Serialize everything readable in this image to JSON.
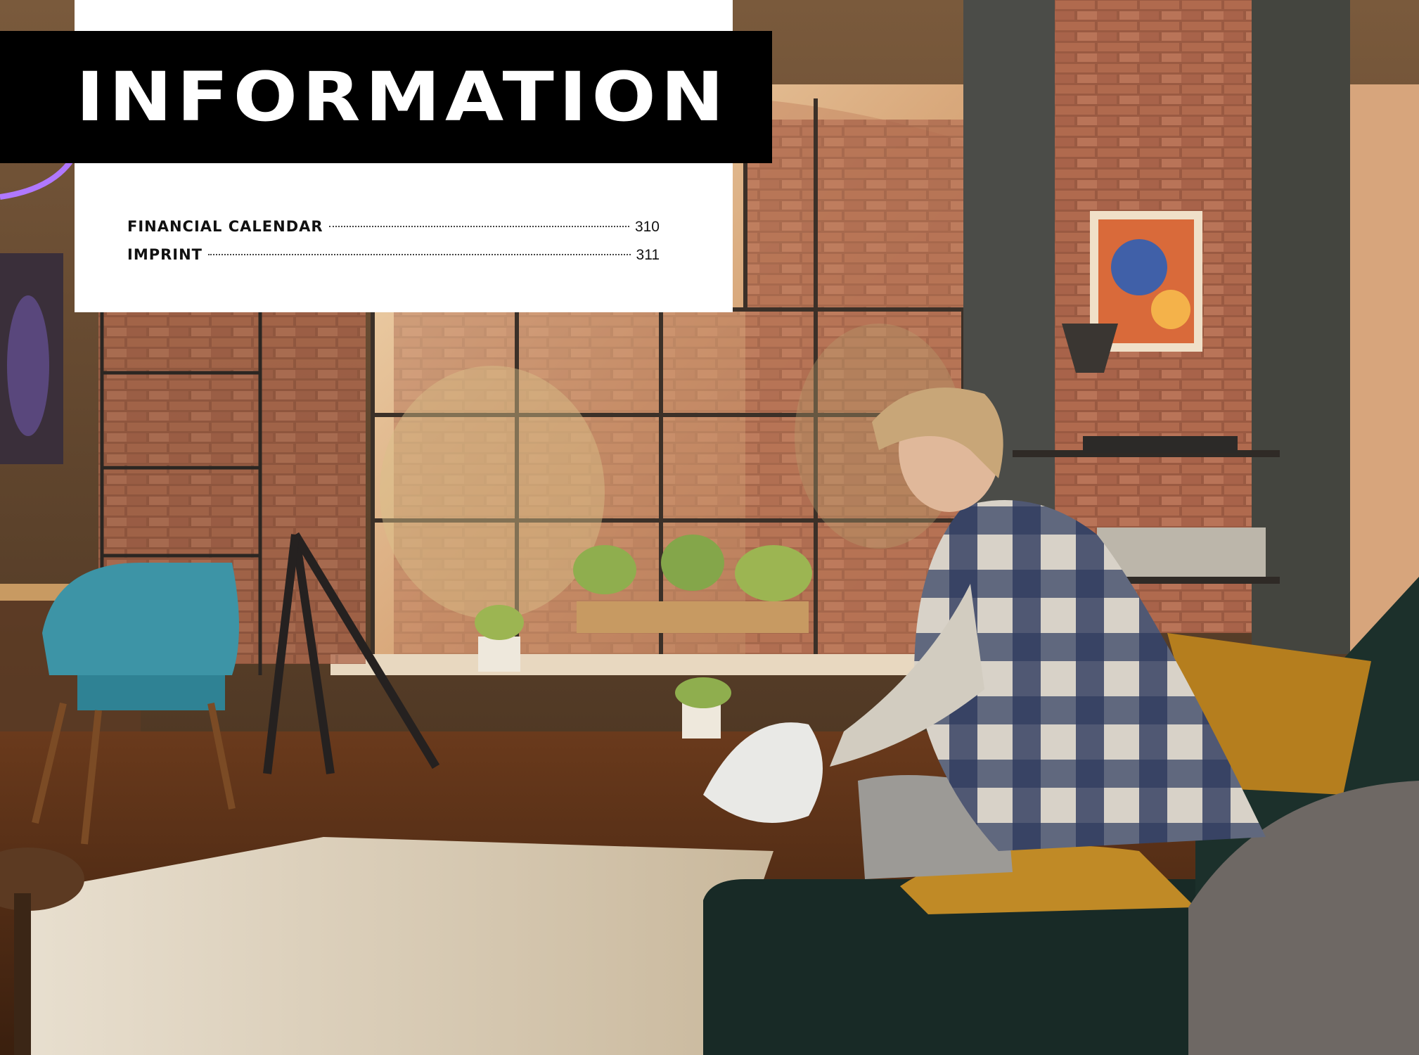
{
  "header": {
    "title": "INFORMATION"
  },
  "toc": {
    "entries": [
      {
        "label": "FINANCIAL CALENDAR",
        "page": "310"
      },
      {
        "label": "IMPRINT",
        "page": "311"
      }
    ]
  },
  "photo": {
    "description_icon": "photo-living-room-vr-headset"
  },
  "colors": {
    "title_bar": "#000000",
    "card": "#ffffff",
    "text": "#111111"
  }
}
